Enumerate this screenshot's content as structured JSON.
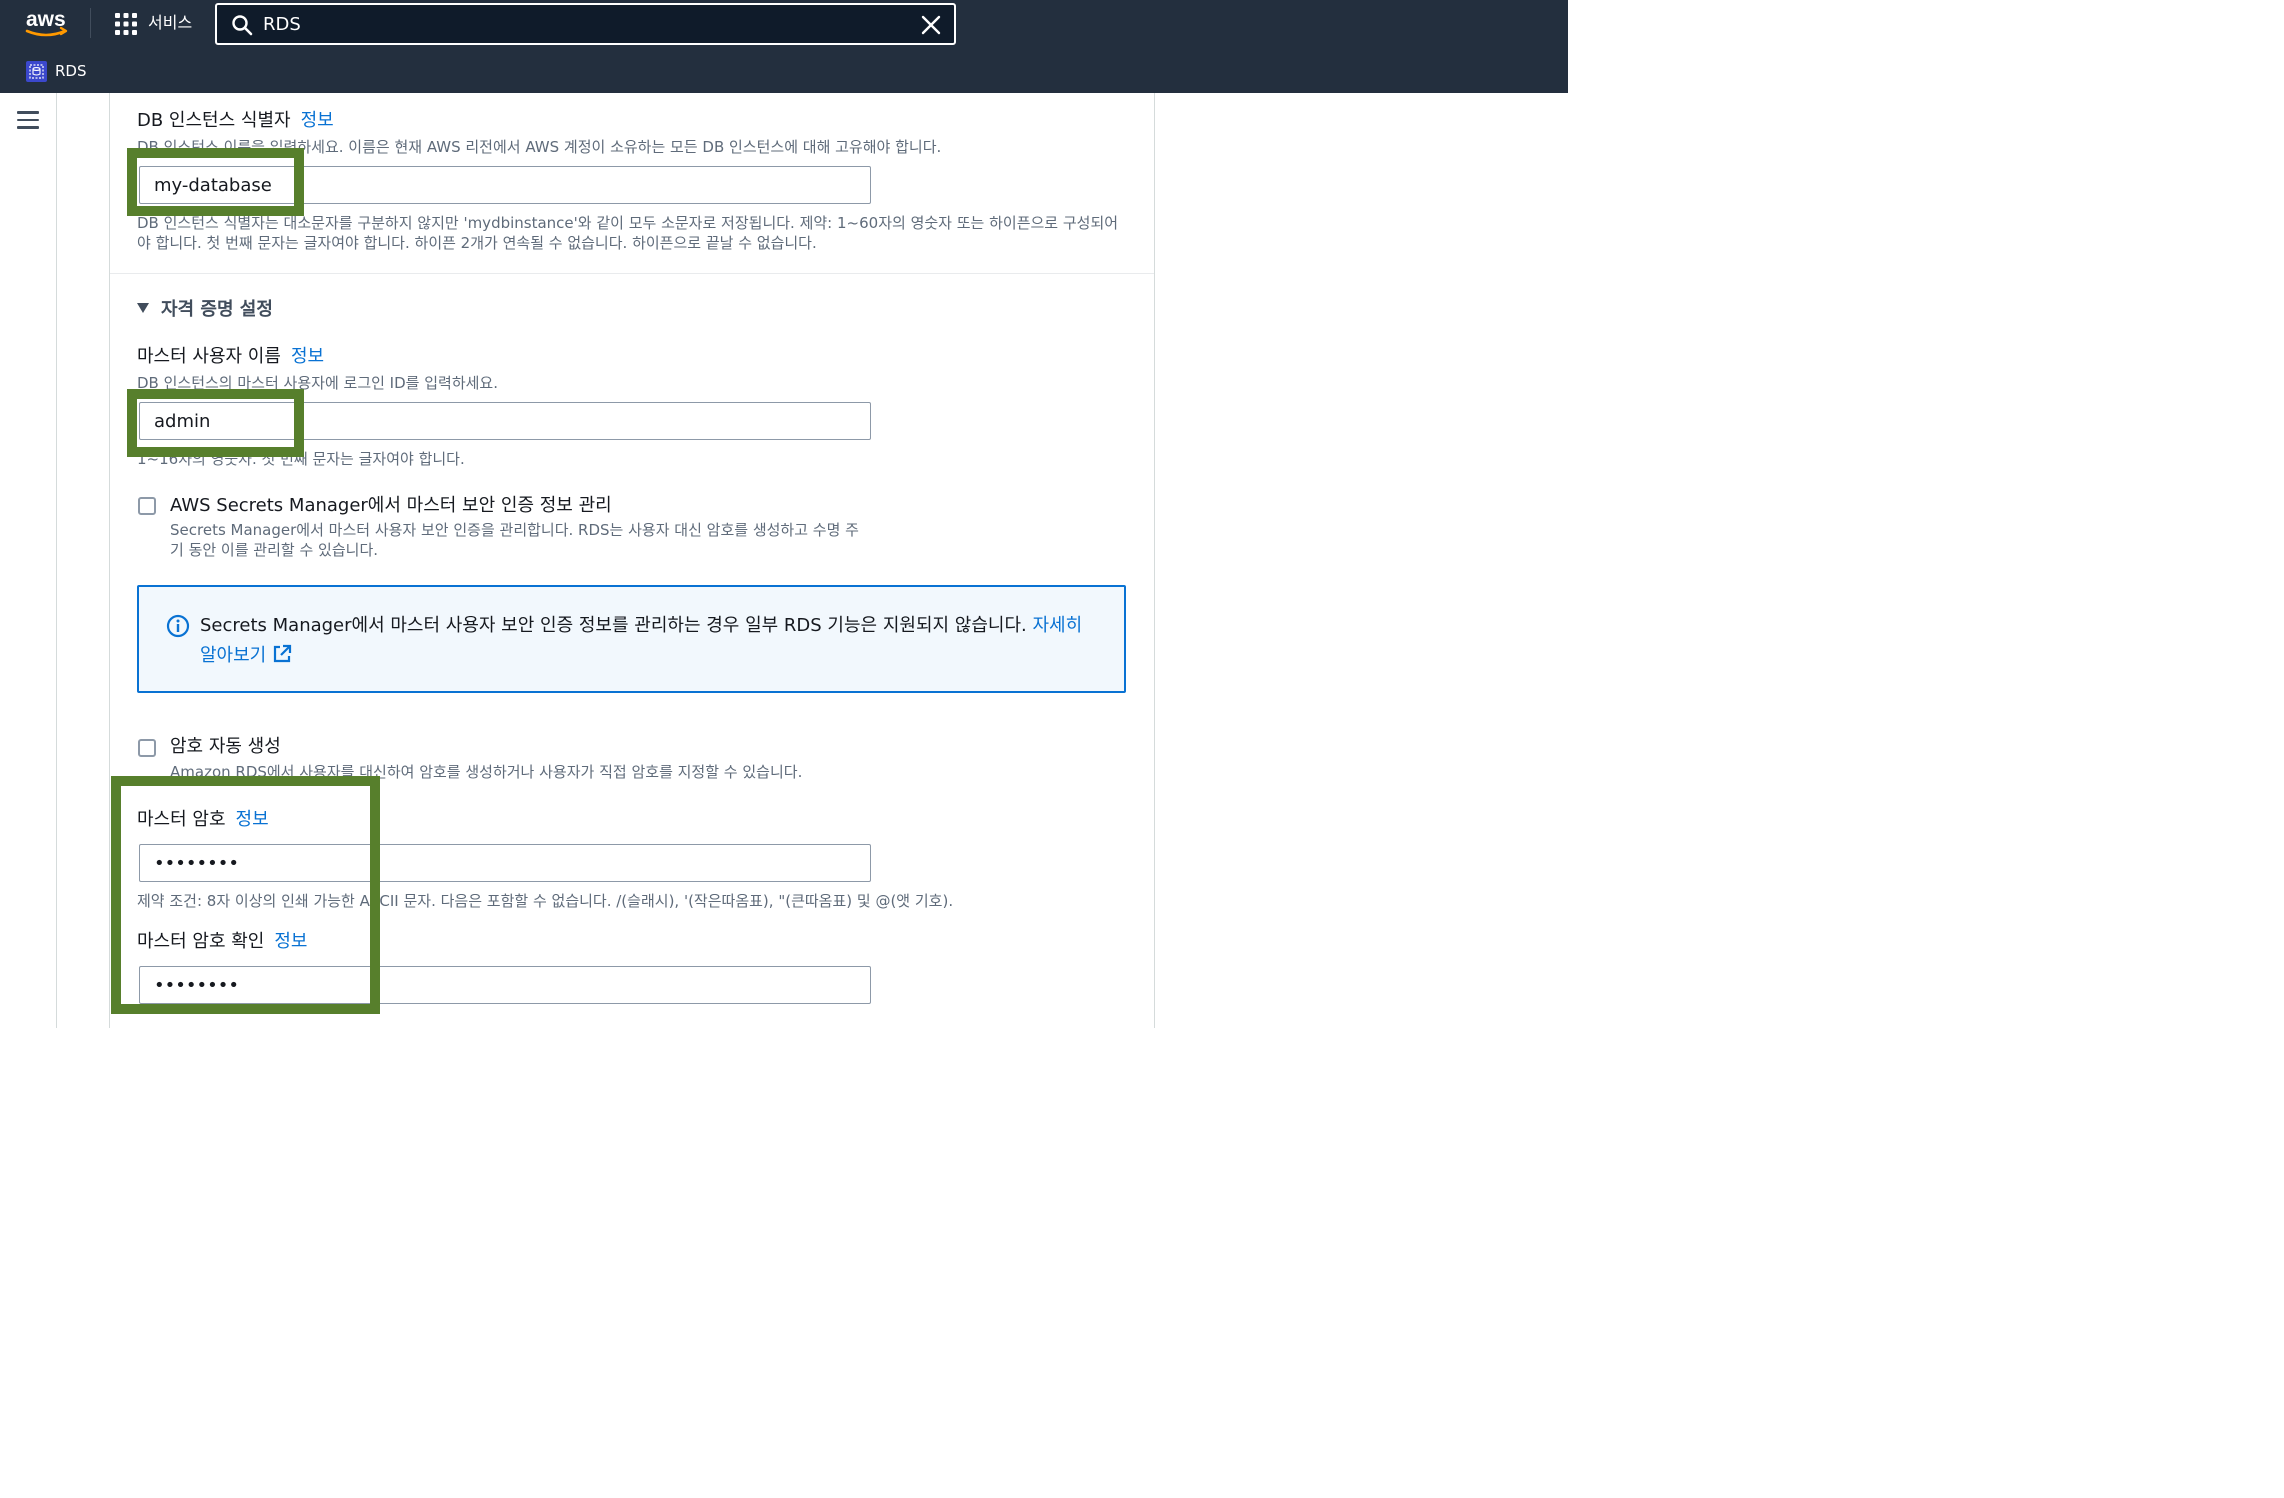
{
  "topnav": {
    "services_label": "서비스",
    "search_value": "RDS",
    "breadcrumb": "RDS"
  },
  "form": {
    "db_identifier": {
      "label": "DB 인스턴스 식별자",
      "info": "정보",
      "description": "DB 인스턴스 이름을 입력하세요. 이름은 현재 AWS 리전에서 AWS 계정이 소유하는 모든 DB 인스턴스에 대해 고유해야 합니다.",
      "value": "my-database",
      "constraint": "DB 인스턴스 식별자는 대소문자를 구분하지 않지만 'mydbinstance'와 같이 모두 소문자로 저장됩니다. 제약: 1~60자의 영숫자 또는 하이픈으로 구성되어야 합니다. 첫 번째 문자는 글자여야 합니다. 하이픈 2개가 연속될 수 없습니다. 하이픈으로 끝날 수 없습니다."
    },
    "credentials_section": {
      "title": "자격 증명 설정"
    },
    "master_username": {
      "label": "마스터 사용자 이름",
      "info": "정보",
      "description": "DB 인스턴스의 마스터 사용자에 로그인 ID를 입력하세요.",
      "value": "admin",
      "constraint": "1~16자의 영숫자. 첫 번째 문자는 글자여야 합니다."
    },
    "secrets_manager": {
      "label": "AWS Secrets Manager에서 마스터 보안 인증 정보 관리",
      "description": "Secrets Manager에서 마스터 사용자 보안 인증을 관리합니다. RDS는 사용자 대신 암호를 생성하고 수명 주기 동안 이를 관리할 수 있습니다.",
      "checked": false
    },
    "alert": {
      "message": "Secrets Manager에서 마스터 사용자 보안 인증 정보를 관리하는 경우 일부 RDS 기능은 지원되지 않습니다.",
      "link": "자세히 알아보기"
    },
    "auto_password": {
      "label": "암호 자동 생성",
      "description": "Amazon RDS에서 사용자를 대신하여 암호를 생성하거나 사용자가 직접 암호를 지정할 수 있습니다.",
      "checked": false
    },
    "master_password": {
      "label": "마스터 암호",
      "info": "정보",
      "value": "••••••••",
      "constraint": "제약 조건: 8자 이상의 인쇄 가능한 ASCII 문자. 다음은 포함할 수 없습니다. /(슬래시), '(작은따옴표), \"(큰따옴표) 및 @(앳 기호)."
    },
    "confirm_password": {
      "label": "마스터 암호 확인",
      "info": "정보",
      "value": "••••••••"
    }
  },
  "colors": {
    "nav_bg": "#232f3e",
    "link": "#0972d3",
    "highlight": "#577f2c",
    "alert_bg": "#f2f8fd"
  }
}
